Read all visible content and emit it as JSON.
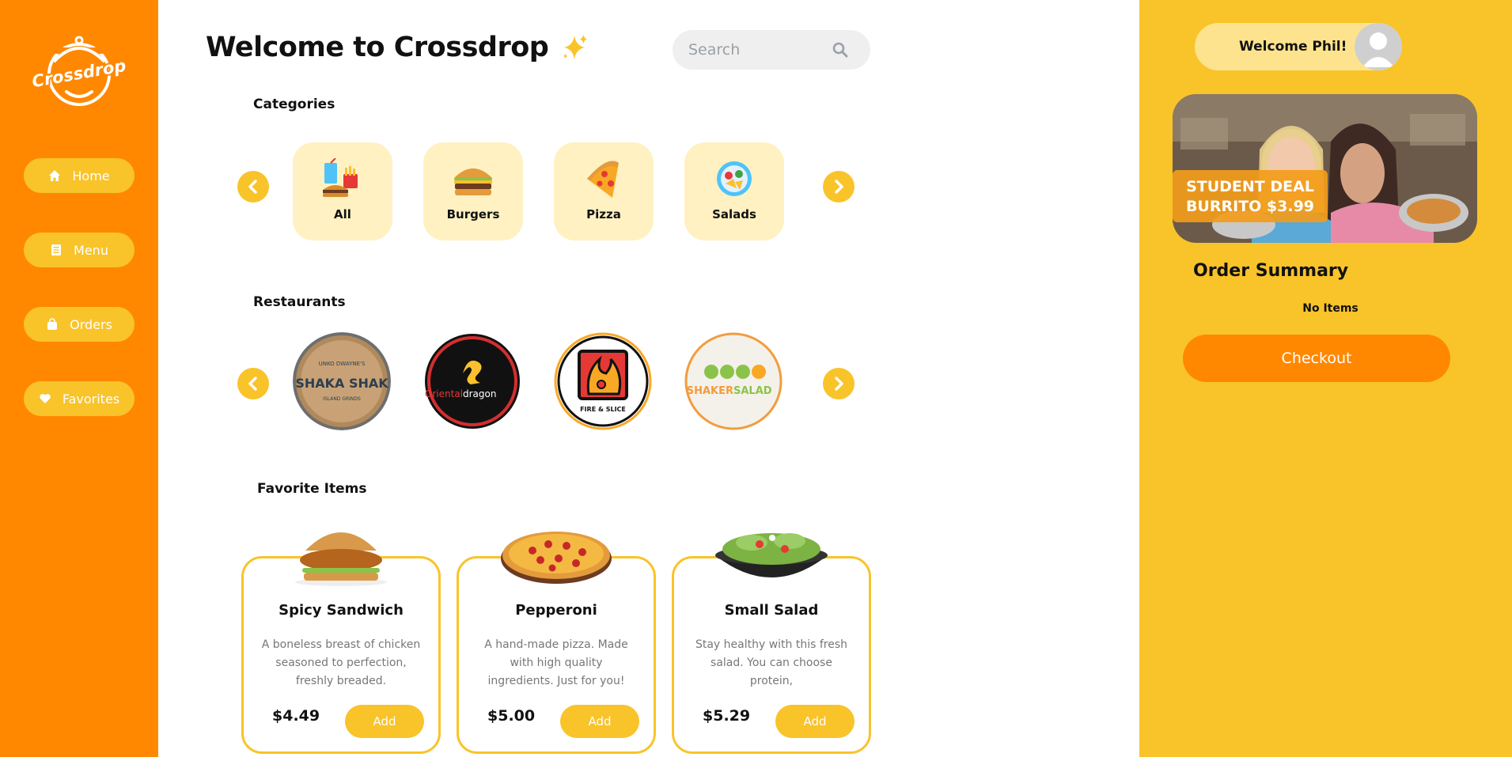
{
  "app": {
    "logo_text": "Crossdrop",
    "title": "Welcome to Crossdrop"
  },
  "sidebar": {
    "items": [
      {
        "label": "Home",
        "icon": "home-icon"
      },
      {
        "label": "Menu",
        "icon": "menu-icon"
      },
      {
        "label": "Orders",
        "icon": "bag-icon"
      },
      {
        "label": "Favorites",
        "icon": "heart-icon"
      }
    ]
  },
  "search": {
    "placeholder": "Search"
  },
  "categories": {
    "label": "Categories",
    "items": [
      {
        "label": "All",
        "icon": "combo-meal-icon"
      },
      {
        "label": "Burgers",
        "icon": "burger-icon"
      },
      {
        "label": "Pizza",
        "icon": "pizza-icon"
      },
      {
        "label": "Salads",
        "icon": "salad-icon"
      }
    ]
  },
  "restaurants": {
    "label": "Restaurants",
    "items": [
      {
        "name": "Shaka Shak",
        "logo_lines": [
          "UNKO DWAYNE'S",
          "SHAKA SHAK",
          "ISLAND GRINDS"
        ]
      },
      {
        "name": "Oriental dragon",
        "logo_lines": [
          "Oriental",
          "dragon"
        ]
      },
      {
        "name": "Fire & Slice",
        "logo_lines": [
          "FIRE & SLICE"
        ]
      },
      {
        "name": "Shaker Salad",
        "logo_lines": [
          "SHAKER",
          "SALAD"
        ]
      }
    ]
  },
  "favorites": {
    "label": "Favorite Items",
    "items": [
      {
        "name": "Spicy Sandwich",
        "description": "A boneless breast of chicken seasoned to perfection, freshly breaded.",
        "price": "$4.49",
        "add_label": "Add"
      },
      {
        "name": "Pepperoni",
        "description": "A hand-made pizza. Made with high quality ingredients. Just for you!",
        "price": "$5.00",
        "add_label": "Add"
      },
      {
        "name": "Small Salad",
        "description": "Stay healthy with this fresh salad. You can choose protein,",
        "price": "$5.29",
        "add_label": "Add"
      }
    ]
  },
  "right_panel": {
    "welcome": "Welcome Phil!",
    "promo_line1": "STUDENT DEAL",
    "promo_line2": "BURRITO $3.99",
    "order_summary_title": "Order Summary",
    "order_status": "No Items",
    "checkout_label": "Checkout"
  },
  "colors": {
    "sidebar": "#ff8800",
    "accent": "#f9c32a",
    "category_card": "#fff1c2",
    "checkout": "#ff8800"
  }
}
